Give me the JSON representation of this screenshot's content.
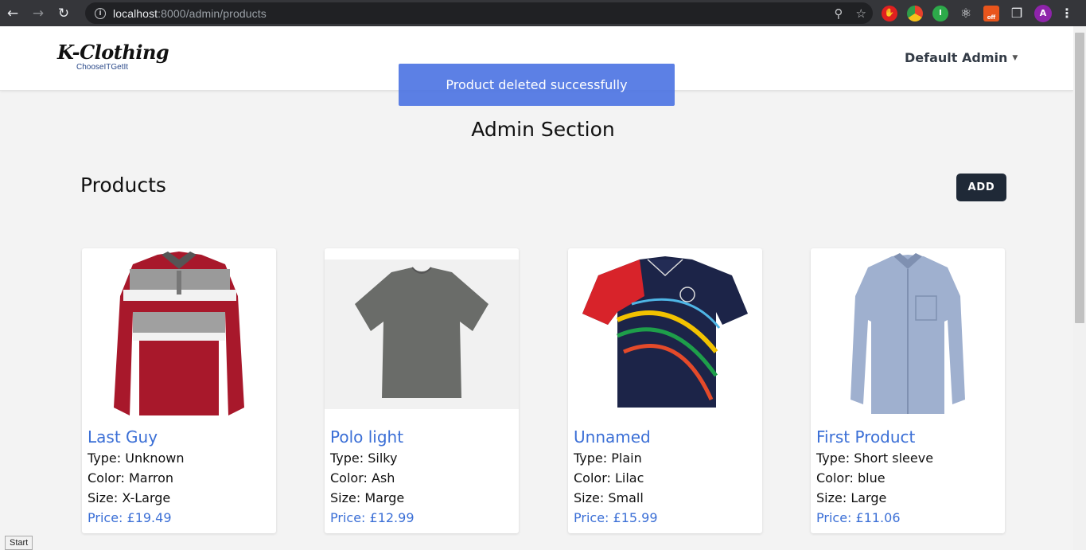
{
  "browser": {
    "url_host": "localhost",
    "url_path": ":8000/admin/products",
    "avatar_letter": "A",
    "ext_off_label": "off"
  },
  "header": {
    "logo_title": "K-Clothing",
    "logo_tagline": "ChooseITGetIt",
    "user_name": "Default Admin"
  },
  "toast": {
    "message": "Product deleted successfully"
  },
  "main": {
    "page_title": "Admin Section",
    "section_title": "Products",
    "add_label": "ADD"
  },
  "products": [
    {
      "name": "Last Guy",
      "type": "Type: Unknown",
      "color": "Color: Marron",
      "size": "Size: X-Large",
      "price": "Price: £19.49"
    },
    {
      "name": "Polo light",
      "type": "Type: Silky",
      "color": "Color: Ash",
      "size": "Size: Marge",
      "price": "Price: £12.99"
    },
    {
      "name": "Unnamed",
      "type": "Type: Plain",
      "color": "Color: Lilac",
      "size": "Size: Small",
      "price": "Price: £15.99"
    },
    {
      "name": "First Product",
      "type": "Type: Short sleeve",
      "color": "Color: blue",
      "size": "Size: Large",
      "price": "Price: £11.06"
    }
  ],
  "status_bar": {
    "text": "Start"
  },
  "colors": {
    "accent_blue": "#3b6fd6",
    "toast_blue": "#466ee1",
    "dark_button": "#1f2937"
  }
}
